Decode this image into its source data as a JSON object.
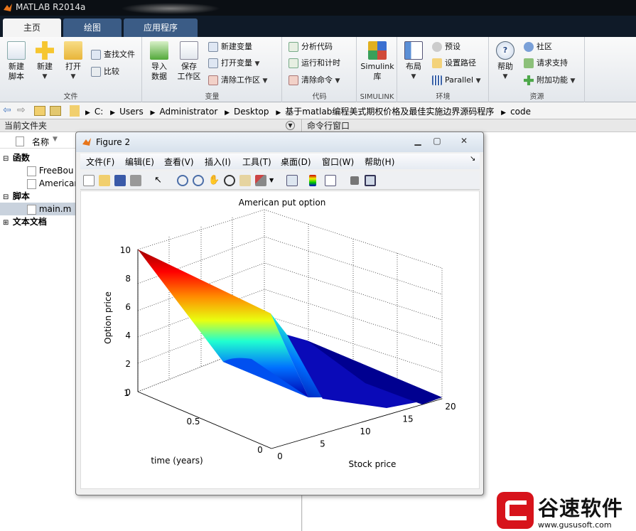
{
  "app": {
    "title": "MATLAB R2014a"
  },
  "tabs": [
    "主页",
    "绘图",
    "应用程序"
  ],
  "ribbon": {
    "file": {
      "label": "文件",
      "new_script": "新建\n脚本",
      "new": "新建",
      "open": "打开",
      "find_files": "查找文件",
      "compare": "比较"
    },
    "variable": {
      "label": "变量",
      "import": "导入\n数据",
      "save_ws": "保存\n工作区",
      "new_var": "新建变量",
      "open_var": "打开变量",
      "clear_ws": "清除工作区"
    },
    "code": {
      "label": "代码",
      "analyze": "分析代码",
      "run_time": "运行和计时",
      "clear_cmd": "清除命令"
    },
    "simulink": {
      "label": "SIMULINK",
      "simulink": "Simulink\n库"
    },
    "env": {
      "label": "环境",
      "layout": "布局",
      "prefs": "预设",
      "set_path": "设置路径",
      "parallel": "Parallel"
    },
    "resources": {
      "label": "资源",
      "help": "帮助",
      "community": "社区",
      "support": "请求支持",
      "addons": "附加功能"
    }
  },
  "address": {
    "segments": [
      "C:",
      "Users",
      "Administrator",
      "Desktop",
      "基于matlab编程美式期权价格及最佳实施边界源码程序",
      "code"
    ]
  },
  "current_folder": {
    "title": "当前文件夹",
    "column": "名称",
    "groups": [
      {
        "name": "函数",
        "items": [
          "FreeBou",
          "Americar"
        ]
      },
      {
        "name": "脚本",
        "items": [
          "main.m"
        ]
      },
      {
        "name": "文本文档",
        "items": []
      }
    ]
  },
  "command_window": {
    "title": "命令行窗口"
  },
  "figure": {
    "title": "Figure 2",
    "menus": [
      "文件(F)",
      "编辑(E)",
      "查看(V)",
      "插入(I)",
      "工具(T)",
      "桌面(D)",
      "窗口(W)",
      "帮助(H)"
    ],
    "plot": {
      "title": "American put option",
      "zlabel": "Option price",
      "xlabel": "Stock price",
      "ylabel": "time (years)",
      "zticks": [
        "0",
        "2",
        "4",
        "6",
        "8",
        "10"
      ],
      "xticks": [
        "0",
        "5",
        "10",
        "15",
        "20"
      ],
      "yticks": [
        "0",
        "0.5",
        "1"
      ]
    }
  },
  "watermark": {
    "brand": "谷速软件",
    "url": "www.gususoft.com"
  },
  "chart_data": {
    "type": "surface",
    "title": "American put option",
    "xlabel": "Stock price",
    "ylabel": "time (years)",
    "zlabel": "Option price",
    "xlim": [
      0,
      20
    ],
    "ylim": [
      0,
      1
    ],
    "zlim": [
      0,
      10
    ],
    "strike": 10,
    "colormap": "jet"
  }
}
